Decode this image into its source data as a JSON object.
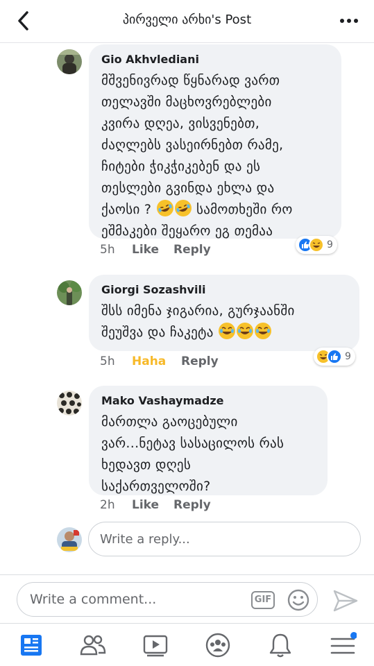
{
  "header": {
    "title": "პირველი არხი's Post"
  },
  "comments": [
    {
      "author": "Gio Akhvlediani",
      "lines": [
        "მშვენივრად წყნარად ვართ",
        "თელავში მაცხოვრებლები",
        "კვირა დღეა, ვისვენებთ,",
        "ძაღლებს ვასეირნებთ რამე,",
        "ჩიტები ჭიკჭიკებენ და ეს",
        "თესლები გვინდა ეხლა და"
      ],
      "line7_a": "ქაოსი ?",
      "line7_b": "სამოთხეში რო",
      "line8": "ეშმაკები შეყარო ეგ თემაა",
      "time": "5h",
      "like": "Like",
      "reply": "Reply",
      "reaction_count": "9"
    },
    {
      "author": "Giorgi Sozashvili",
      "line1": "შსს იმენა ჯიგარია,  გურჯაანში",
      "line2": "შეუშვა და ჩაკეტა",
      "time": "5h",
      "like": "Haha",
      "reply": "Reply",
      "reaction_count": "9"
    },
    {
      "author": "Mako Vashaymadze",
      "lines": [
        "მართლა გაოცებული",
        "ვარ...ნეტავ სასაცილოს რას",
        "ხედავთ დღეს",
        "საქართველოში?"
      ],
      "time": "2h",
      "like": "Like",
      "reply": "Reply"
    }
  ],
  "reply_box": {
    "placeholder": "Write a reply..."
  },
  "composer": {
    "placeholder": "Write a comment...",
    "gif_label": "GIF"
  },
  "colors": {
    "like_blue": "#1877f2",
    "haha_yellow": "#f7b928",
    "bubble_bg": "#f0f2f5"
  },
  "icons": [
    "back-icon",
    "more-icon",
    "gif-icon",
    "smile-icon",
    "send-icon",
    "news-feed-icon",
    "friends-icon",
    "watch-icon",
    "groups-icon",
    "notifications-icon",
    "menu-icon"
  ]
}
